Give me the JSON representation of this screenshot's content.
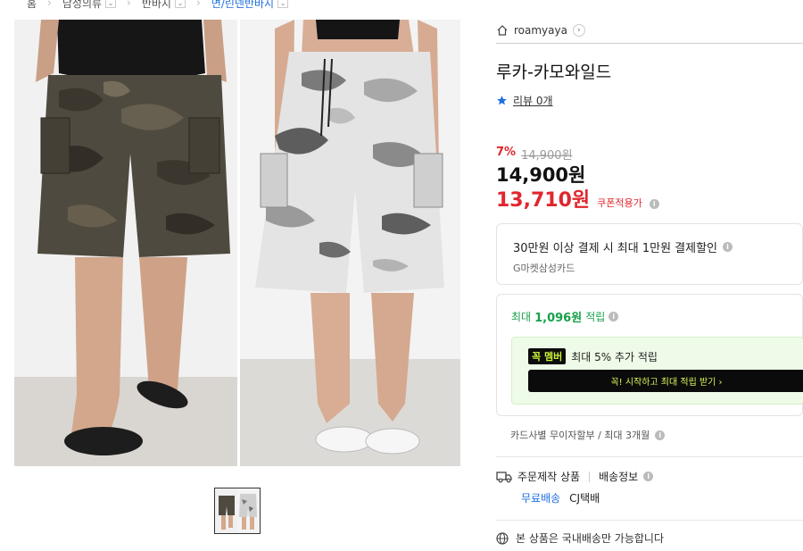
{
  "breadcrumb": {
    "items": [
      {
        "label": "홈",
        "dropdown": false
      },
      {
        "label": "남성의류",
        "dropdown": true
      },
      {
        "label": "반바지",
        "dropdown": true
      },
      {
        "label": "면/린넨반바지",
        "dropdown": true
      }
    ],
    "dropdown_glyph": "⌄"
  },
  "store": {
    "name": "roamyaya",
    "chevron": "›"
  },
  "product": {
    "title": "루카-카모와일드",
    "review_label": "리뷰 0개",
    "discount_rate": "7%",
    "original_price": "14,900원",
    "price": "14,900원",
    "sale_price": "13,710원",
    "coupon_label": "쿠폰적용가"
  },
  "card_offer": {
    "title": "30만원 이상 결제 시 최대 1만원 결제할인",
    "card_name": "G마켓삼성카드"
  },
  "points": {
    "prefix": "최대",
    "amount": "1,096원",
    "suffix": "적립",
    "member_badge": "꼭 멤버",
    "member_text": "최대 5% 추가 적립",
    "member_button": "꼭! 시작하고 최대 적립 받기 ›"
  },
  "installment": "카드사별 무이자할부 / 최대 3개월",
  "shipping": {
    "type": "주문제작 상품",
    "info_label": "배송정보",
    "free": "무료배송",
    "carrier": "CJ택배"
  },
  "domestic_note": "본 상품은 국내배송만 가능합니다",
  "icons": {
    "store": "house-icon",
    "review": "star-icon",
    "info": "info-icon",
    "truck": "truck-icon",
    "globe": "globe-icon"
  },
  "colors": {
    "accent_red": "#e0272d",
    "accent_blue": "#1f6fe0",
    "points_green": "#17a04a",
    "member_bg": "#eefbe8"
  }
}
